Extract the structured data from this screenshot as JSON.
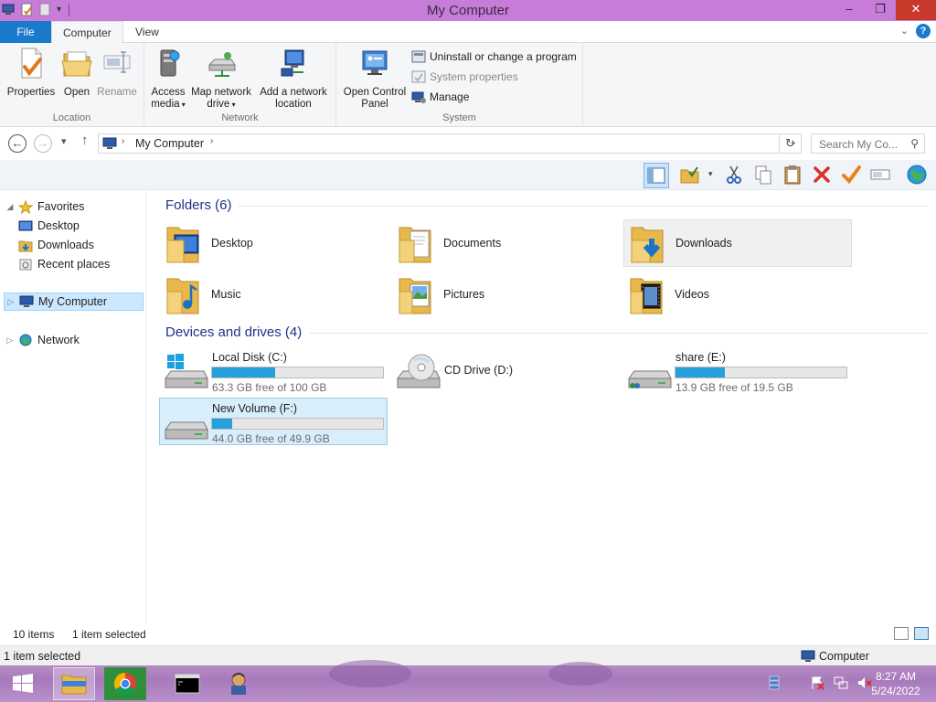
{
  "window": {
    "title": "My Computer",
    "controls": {
      "minimize": "–",
      "maximize": "❐",
      "close": "✕"
    }
  },
  "ribbon_tabs": {
    "file": "File",
    "computer": "Computer",
    "view": "View"
  },
  "ribbon": {
    "location": {
      "label": "Location",
      "properties": "Properties",
      "open": "Open",
      "rename": "Rename"
    },
    "network": {
      "label": "Network",
      "access_media_1": "Access",
      "access_media_2": "media",
      "map_drive_1": "Map network",
      "map_drive_2": "drive",
      "add_location_1": "Add a network",
      "add_location_2": "location"
    },
    "system": {
      "label": "System",
      "open_cp_1": "Open Control",
      "open_cp_2": "Panel",
      "uninstall": "Uninstall or change a program",
      "system_properties": "System properties",
      "manage": "Manage"
    }
  },
  "address": {
    "location": "My Computer",
    "search_placeholder": "Search My Co..."
  },
  "nav_pane": {
    "favorites": "Favorites",
    "desktop": "Desktop",
    "downloads": "Downloads",
    "recent": "Recent places",
    "my_computer": "My Computer",
    "network": "Network"
  },
  "folders": {
    "header": "Folders (6)",
    "items": [
      {
        "name": "Desktop"
      },
      {
        "name": "Documents"
      },
      {
        "name": "Downloads"
      },
      {
        "name": "Music"
      },
      {
        "name": "Pictures"
      },
      {
        "name": "Videos"
      }
    ]
  },
  "drives": {
    "header": "Devices and drives (4)",
    "items": [
      {
        "name": "Local Disk (C:)",
        "free": "63.3 GB free of 100 GB",
        "used_fraction": 0.367
      },
      {
        "name": "CD Drive (D:)"
      },
      {
        "name": "share (E:)",
        "free": "13.9 GB free of 19.5 GB",
        "used_fraction": 0.287
      },
      {
        "name": "New Volume (F:)",
        "free": "44.0 GB free of 49.9 GB",
        "used_fraction": 0.118
      }
    ]
  },
  "status": {
    "items": "10 items",
    "selected": "1 item selected"
  },
  "details": {
    "selected": "1 item selected",
    "zone": "Computer"
  },
  "taskbar": {
    "time": "8:27 AM",
    "date": "5/24/2022"
  },
  "colors": {
    "title_bar": "#c67cd8",
    "file_tab": "#1979ca",
    "progress": "#26a0da",
    "section_header": "#1e3287",
    "close_button": "#c8382b"
  }
}
